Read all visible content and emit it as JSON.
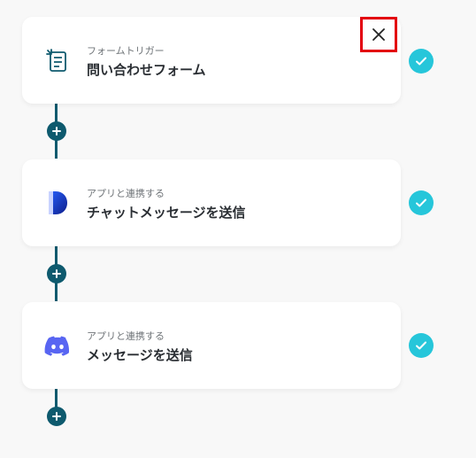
{
  "flow": {
    "steps": [
      {
        "subtitle": "フォームトリガー",
        "title": "問い合わせフォーム",
        "icon": "form-icon"
      },
      {
        "subtitle": "アプリと連携する",
        "title": "チャットメッセージを送信",
        "icon": "app-d-logo-icon"
      },
      {
        "subtitle": "アプリと連携する",
        "title": "メッセージを送信",
        "icon": "discord-icon"
      }
    ],
    "status": "completed"
  },
  "colors": {
    "connector": "#0e5a6e",
    "check": "#26c6da",
    "highlight": "#e3000f"
  }
}
